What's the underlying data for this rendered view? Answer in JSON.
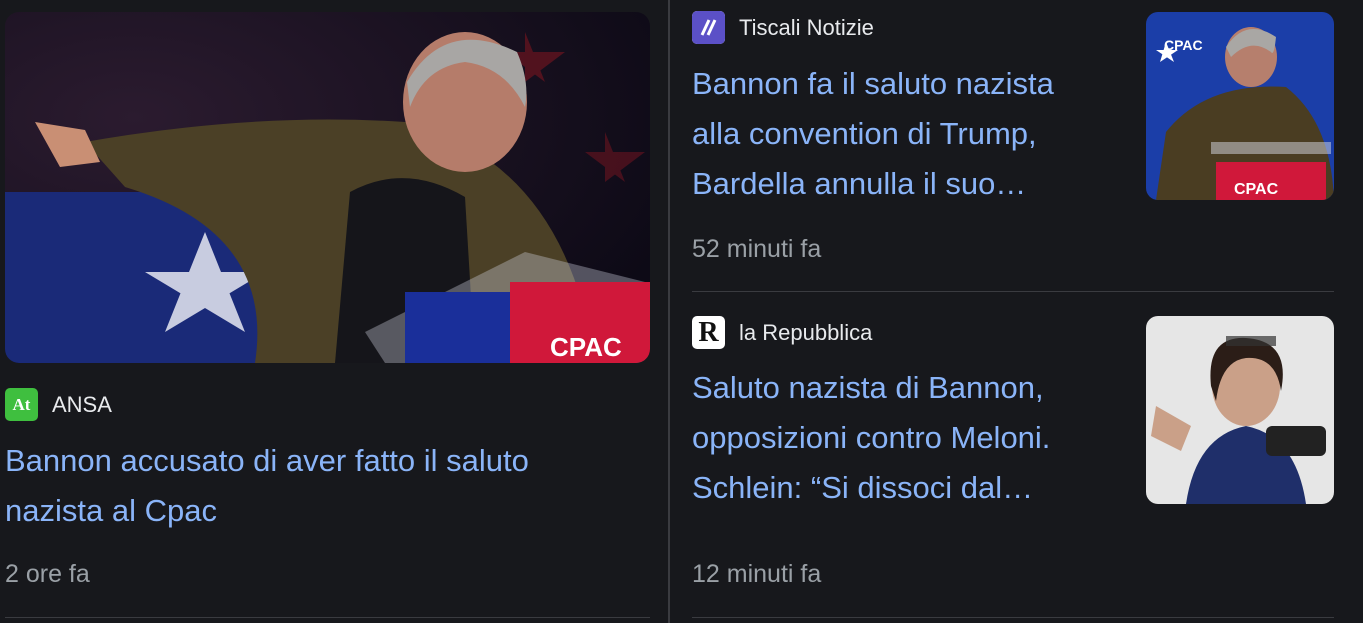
{
  "stories": {
    "main": {
      "source": "ANSA",
      "headline": "Bannon accusato di aver fatto il saluto nazista al Cpac",
      "time": "2 ore fa",
      "logo_text": "At"
    },
    "side1": {
      "source": "Tiscali Notizie",
      "headline": "Bannon fa il saluto nazista alla convention di Trump, Bardella annulla il suo…",
      "time": "52 minuti fa"
    },
    "side2": {
      "source": "la Repubblica",
      "headline": "Saluto nazista di Bannon, opposizioni contro Meloni. Schlein: “Si dissoci dal…",
      "time": "12 minuti fa",
      "logo_text": "R"
    }
  },
  "image_text": {
    "cpac": "CPAC"
  },
  "colors": {
    "background": "#17181c",
    "link": "#8ab4f8",
    "ansa_green": "#3fbf3f",
    "tiscali_purple": "#5b50c7"
  }
}
